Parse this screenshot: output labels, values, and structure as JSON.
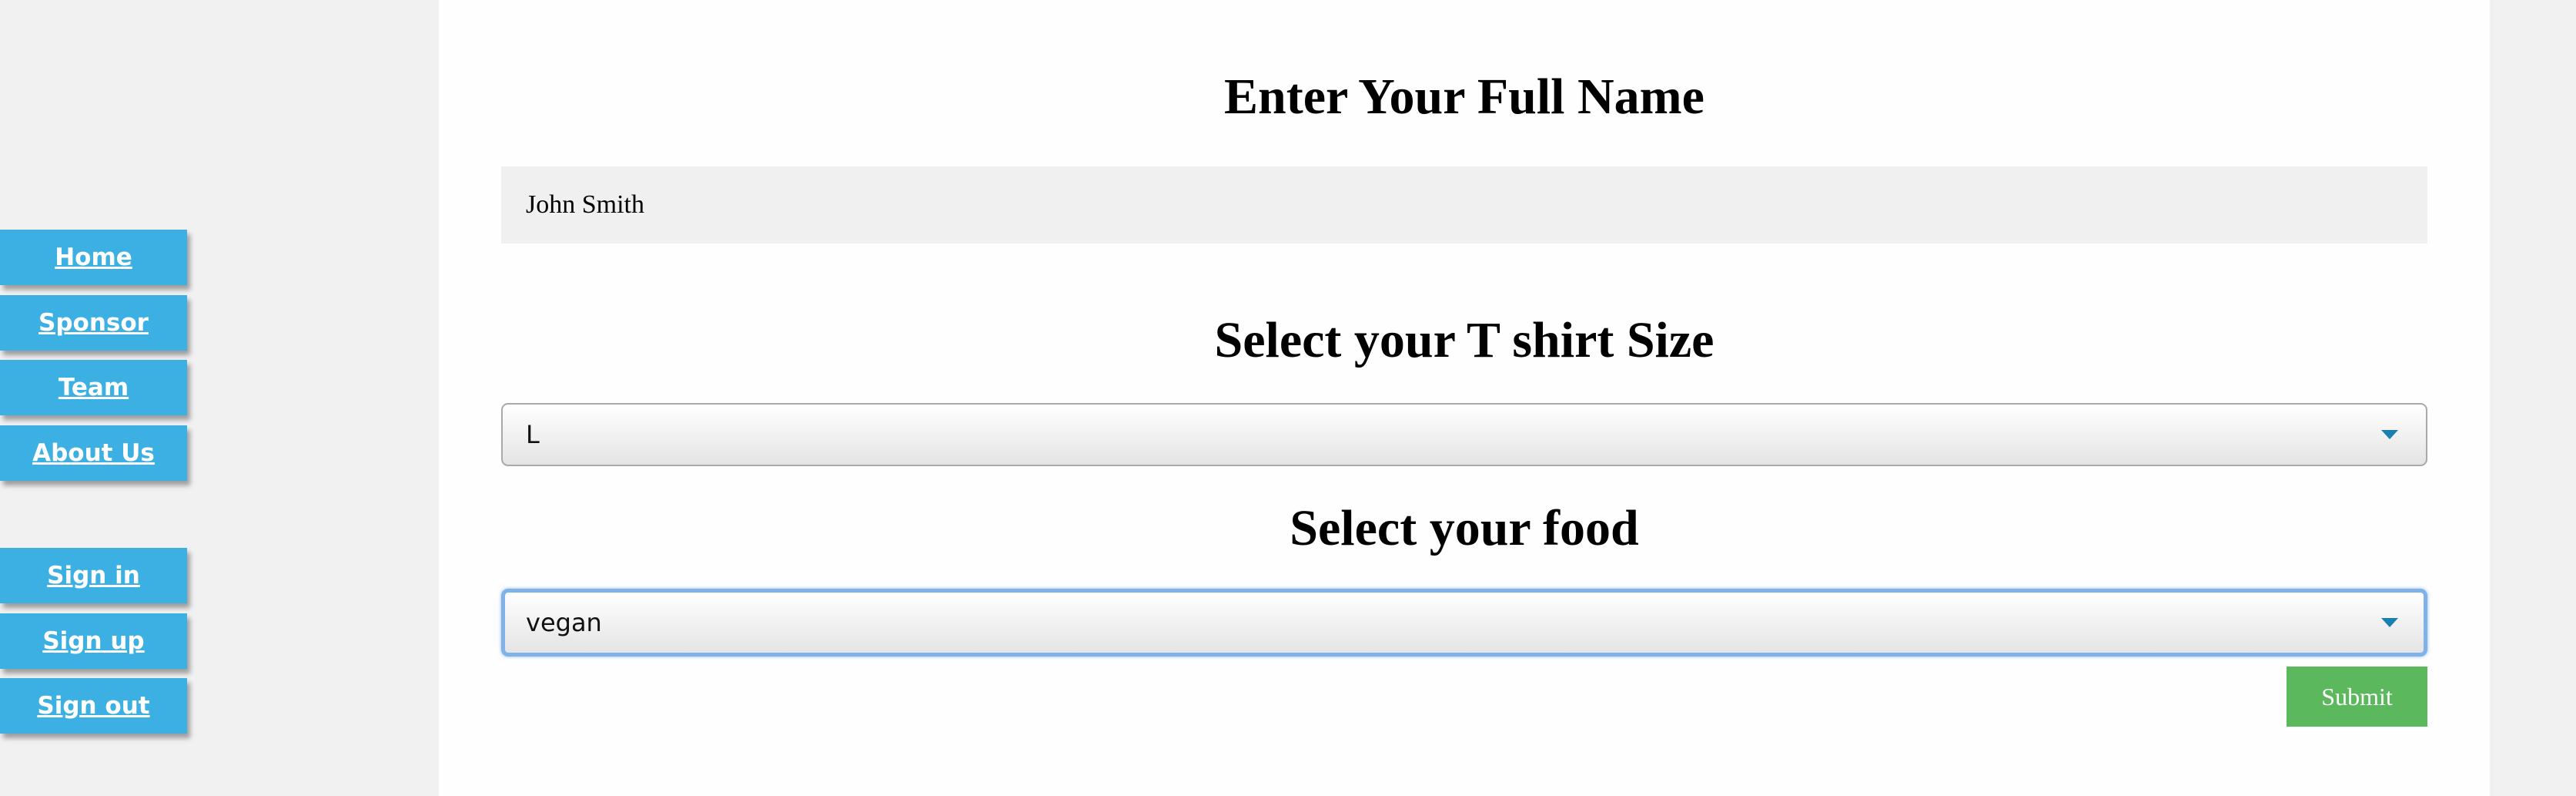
{
  "nav": {
    "primary": [
      "Home",
      "Sponsor",
      "Team",
      "About Us"
    ],
    "account": [
      "Sign in",
      "Sign up",
      "Sign out"
    ]
  },
  "form": {
    "name_heading": "Enter Your Full Name",
    "name_value": "John Smith",
    "size_heading": "Select your T shirt Size",
    "size_selected": "L",
    "food_heading": "Select your food",
    "food_selected": "vegan",
    "submit_label": "Submit"
  },
  "colors": {
    "nav_button": "#3cb0e2",
    "submit_button": "#5cb85c",
    "focus_ring": "#7fb2e6"
  },
  "icons": {
    "select_arrow": "chevron-down-icon"
  }
}
